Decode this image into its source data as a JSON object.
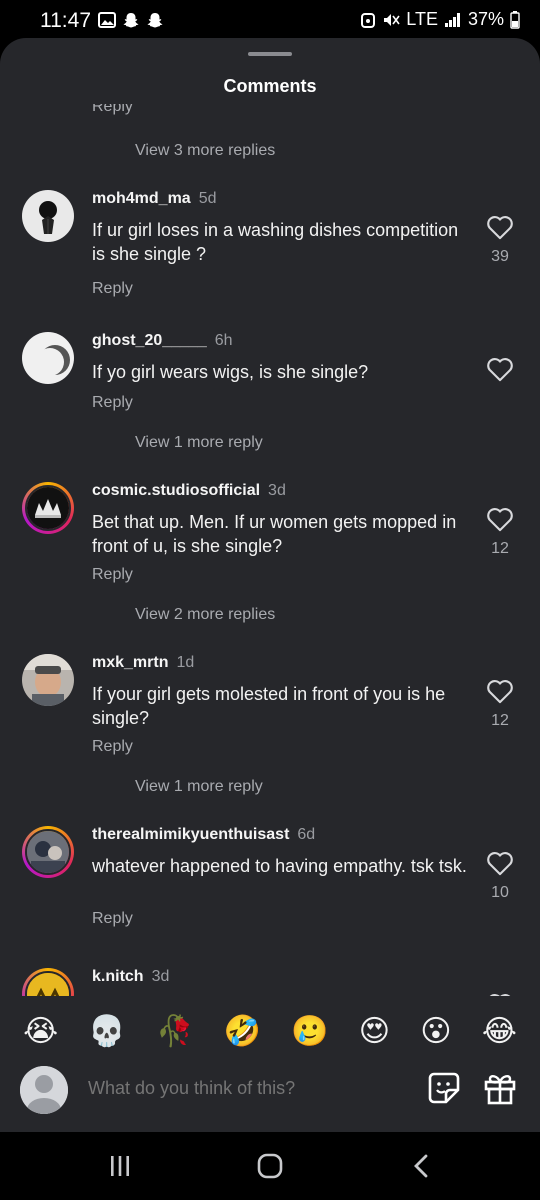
{
  "status": {
    "time": "11:47",
    "network": "LTE",
    "battery": "37%"
  },
  "sheet": {
    "title": "Comments"
  },
  "thread": {
    "partial_reply": "Reply",
    "view_more_1": "View 3 more replies",
    "view_more_2": "View 1 more reply",
    "view_more_3": "View 2 more replies",
    "view_more_4": "View 1 more reply"
  },
  "comments": [
    {
      "user": "moh4md_ma",
      "time": "5d",
      "text": "If ur girl loses in a washing dishes competition is she single ?",
      "reply": "Reply",
      "likes": "39"
    },
    {
      "user": "ghost_20_____",
      "time": "6h",
      "text": "If yo girl wears wigs, is she single?",
      "reply": "Reply",
      "likes": ""
    },
    {
      "user": "cosmic.studiosofficial",
      "time": "3d",
      "text": "Bet that up. Men. If ur women gets mopped in front of u, is she single?",
      "reply": "Reply",
      "likes": "12"
    },
    {
      "user": "mxk_mrtn",
      "time": "1d",
      "text": "If your girl gets molested in front of you is he single?",
      "reply": "Reply",
      "likes": "12"
    },
    {
      "user": "therealmimikyuenthuisast",
      "time": "6d",
      "text": "whatever happened to having empathy. tsk tsk.",
      "reply": "Reply",
      "likes": "10"
    },
    {
      "user": "k.nitch",
      "time": "3d"
    }
  ],
  "emojis": [
    "😭",
    "💀",
    "🥀",
    "🤣",
    "🥲",
    "😍",
    "😮",
    "😂"
  ],
  "compose": {
    "placeholder": "What do you think of this?"
  },
  "icons": {
    "like": "heart-outline-icon",
    "sticker": "sticker-icon",
    "gift": "gift-icon",
    "recents": "recents-icon",
    "home": "home-icon",
    "back": "back-icon"
  }
}
